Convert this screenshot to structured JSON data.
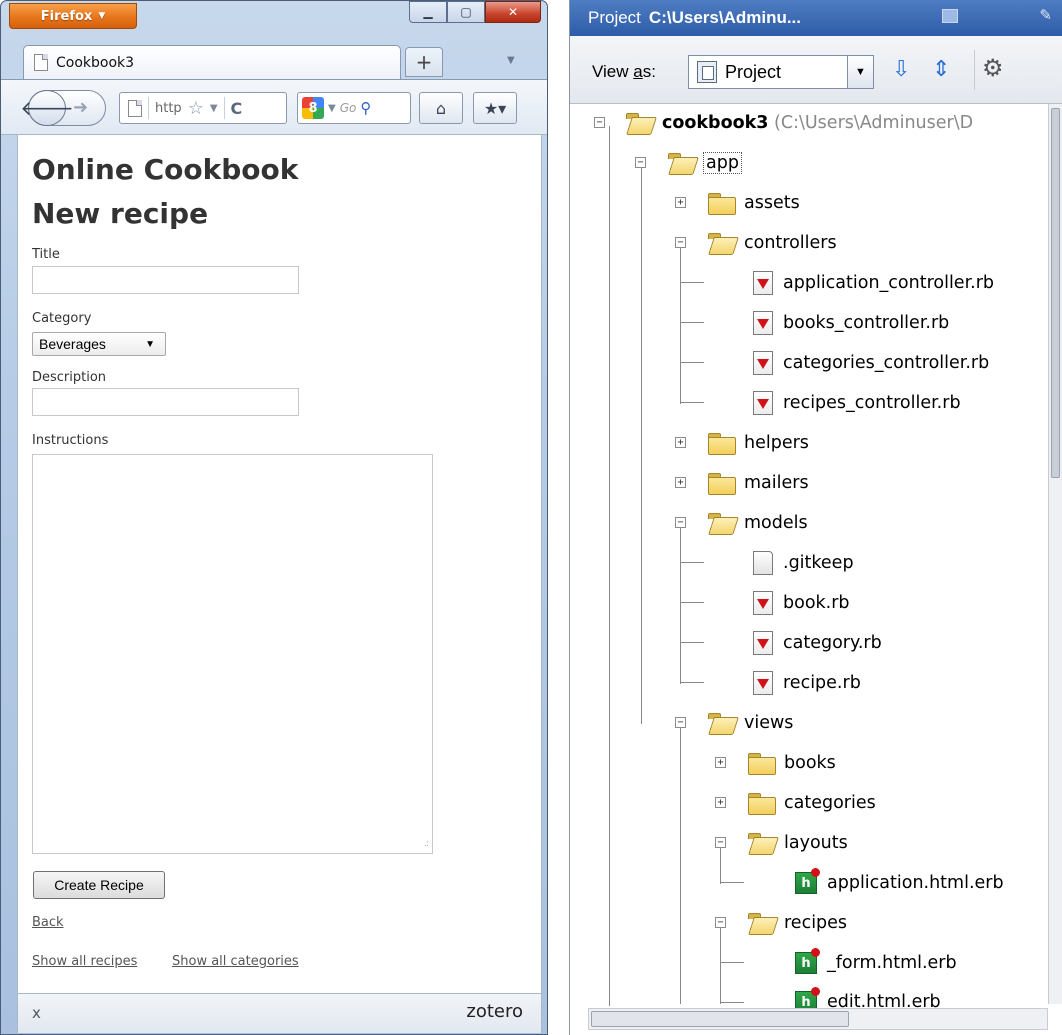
{
  "browser": {
    "app_button": "Firefox",
    "tab_title": "Cookbook3",
    "url_text": "http",
    "search_placeholder": "Go",
    "window_controls": [
      "minimize",
      "maximize",
      "close"
    ]
  },
  "page": {
    "heading_line1": "Online Cookbook",
    "heading_line2": "New recipe",
    "title_label": "Title",
    "title_value": "",
    "category_label": "Category",
    "category_value": "Beverages",
    "description_label": "Description",
    "description_value": "",
    "instructions_label": "Instructions",
    "instructions_value": "",
    "submit_label": "Create Recipe",
    "back_link": "Back",
    "show_recipes_link": "Show all recipes",
    "show_categories_link": "Show all categories"
  },
  "addon_bar": {
    "close_glyph": "x",
    "zotero_label": "zotero"
  },
  "project_panel": {
    "title_prefix": "Project",
    "title_path": "C:\\Users\\Adminu...",
    "view_as_label_pre": "View ",
    "view_as_label_underlined": "a",
    "view_as_label_post": "s:",
    "view_as_value": "Project",
    "tree": {
      "root_name": "cookbook3",
      "root_path": "(C:\\Users\\Adminuser\\D",
      "app": "app",
      "assets": "assets",
      "controllers": "controllers",
      "controller_files": [
        "application_controller.rb",
        "books_controller.rb",
        "categories_controller.rb",
        "recipes_controller.rb"
      ],
      "helpers": "helpers",
      "mailers": "mailers",
      "models": "models",
      "model_files": [
        ".gitkeep",
        "book.rb",
        "category.rb",
        "recipe.rb"
      ],
      "views": "views",
      "books": "books",
      "categories": "categories",
      "layouts": "layouts",
      "layout_files": [
        "application.html.erb"
      ],
      "recipes": "recipes",
      "recipe_files": [
        "_form.html.erb",
        "edit.html.erb"
      ]
    }
  }
}
